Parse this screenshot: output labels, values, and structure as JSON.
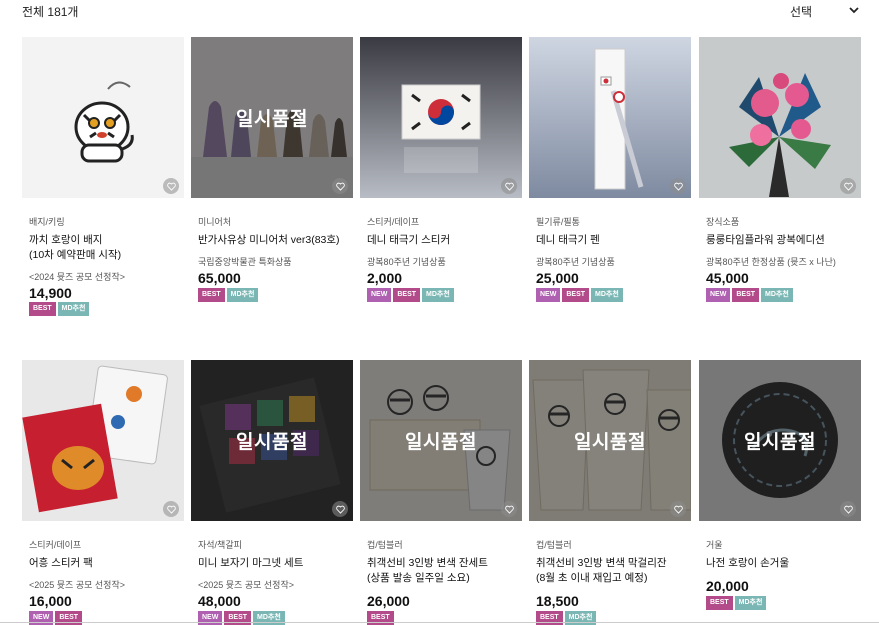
{
  "header": {
    "total_label": "전체 181개",
    "sort_label": "선택",
    "sort_icon": "chevron-down-icon"
  },
  "soldout_label": "일시품절",
  "badge_labels": {
    "new": "NEW",
    "best": "BEST",
    "md": "MD추천"
  },
  "products": [
    {
      "category": "배지/키링",
      "name": "까치 호랑이 배지",
      "name2": "(10차 예약판매 시작)",
      "sub": "<2024 뮷즈 공모 선정작>",
      "price": "14,900",
      "badges": [
        "best",
        "md"
      ],
      "soldout": false,
      "image": "tiger-badge"
    },
    {
      "category": "미니어처",
      "name": "반가사유상 미니어처 ver3(83호)",
      "name2": "",
      "sub": "국립중앙박물관 특화상품",
      "price": "65,000",
      "badges": [
        "best",
        "md"
      ],
      "soldout": true,
      "image": "pensive-bodhisattva-miniatures"
    },
    {
      "category": "스티커/데이프",
      "name": "데니 태극기 스티커",
      "name2": "",
      "sub": "광복80주년 기념상품",
      "price": "2,000",
      "badges": [
        "new",
        "best",
        "md"
      ],
      "soldout": false,
      "image": "taegukgi-sticker"
    },
    {
      "category": "필기류/필통",
      "name": "데니 태극기 펜",
      "name2": "",
      "sub": "광복80주년 기념상품",
      "price": "25,000",
      "badges": [
        "new",
        "best",
        "md"
      ],
      "soldout": false,
      "image": "taegukgi-pen"
    },
    {
      "category": "장식소품",
      "name": "룽룽타임플라워 광복에디션",
      "name2": "",
      "sub": "광복80주년 한정상품 (뮷즈 x 나난)",
      "price": "45,000",
      "badges": [
        "new",
        "best",
        "md"
      ],
      "soldout": false,
      "image": "paper-flower"
    },
    {
      "category": "스티커/데이프",
      "name": "어흥 스티커 팩",
      "name2": "",
      "sub": "<2025 뮷즈 공모 선정작>",
      "price": "16,000",
      "badges": [
        "new",
        "best"
      ],
      "soldout": false,
      "image": "tiger-sticker-pack"
    },
    {
      "category": "자석/책갈피",
      "name": "미니 보자기 마그넷 세트",
      "name2": "",
      "sub": "<2025 뮷즈 공모 선정작>",
      "price": "48,000",
      "badges": [
        "new",
        "best",
        "md"
      ],
      "soldout": true,
      "image": "bojagi-magnet-set"
    },
    {
      "category": "컵/텀블러",
      "name": "취객선비 3인방 변색 잔세트",
      "name2": "(상품 발송 일주일 소요)",
      "sub": "",
      "price": "26,000",
      "badges": [
        "best"
      ],
      "soldout": true,
      "image": "scholar-cup-set"
    },
    {
      "category": "컵/텀블러",
      "name": "취객선비 3인방 변색 막걸리잔",
      "name2": "(8월 초 이내 재입고 예정)",
      "sub": "",
      "price": "18,500",
      "badges": [
        "best",
        "md"
      ],
      "soldout": true,
      "image": "scholar-makgeolli-cup"
    },
    {
      "category": "거울",
      "name": "나전 호랑이 손거울",
      "name2": "",
      "sub": "",
      "price": "20,000",
      "badges": [
        "best",
        "md"
      ],
      "soldout": true,
      "image": "mother-of-pearl-mirror"
    }
  ]
}
